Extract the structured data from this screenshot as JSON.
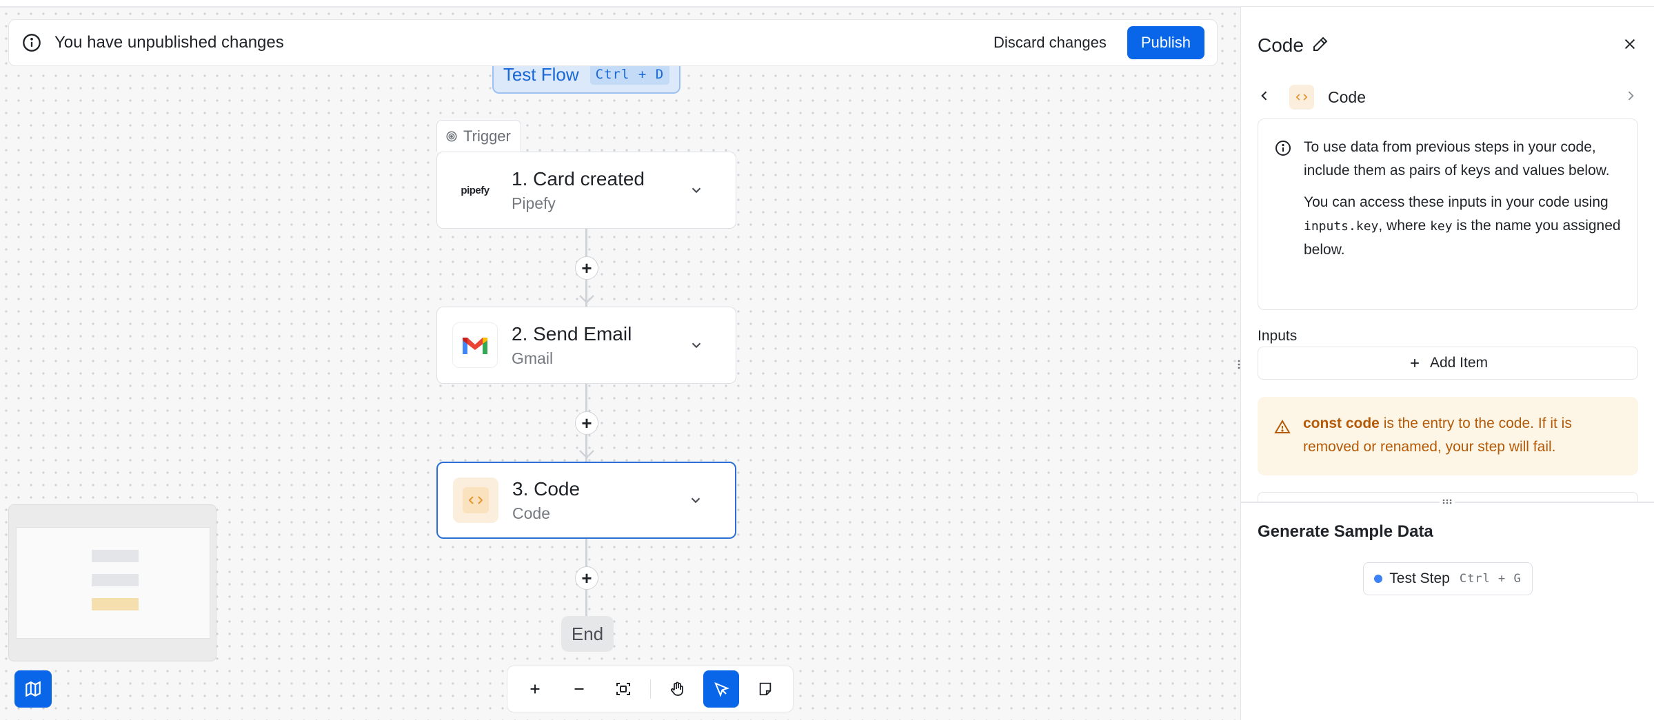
{
  "banner": {
    "message": "You have unpublished changes",
    "discard_label": "Discard changes",
    "publish_label": "Publish"
  },
  "test_flow": {
    "label": "Test Flow",
    "shortcut": "Ctrl + D"
  },
  "trigger_tag": "Trigger",
  "steps": [
    {
      "title": "1. Card created",
      "subtitle": "Pipefy",
      "logo_text": "pipefy",
      "icon": "pipefy-logo"
    },
    {
      "title": "2. Send Email",
      "subtitle": "Gmail",
      "icon": "gmail-icon"
    },
    {
      "title": "3. Code",
      "subtitle": "Code",
      "icon": "code-icon"
    }
  ],
  "end_label": "End",
  "panel": {
    "title": "Code",
    "step_name": "Code",
    "info_paragraph_1": "To use data from previous steps in your code, include them as pairs of keys and values below.",
    "info_p2_a": "You can access these inputs in your code using ",
    "info_p2_code1": "inputs.key",
    "info_p2_b": ", where ",
    "info_p2_code2": "key",
    "info_p2_c": " is the name you assigned below.",
    "inputs_label": "Inputs",
    "add_item_label": "Add Item",
    "warning_bold": "const code",
    "warning_text": " is the entry to the code. If it is removed or renamed, your step will fail.",
    "generate_title": "Generate Sample Data",
    "test_step_label": "Test Step",
    "test_step_shortcut": "Ctrl + G"
  },
  "colors": {
    "accent": "#0a66e8",
    "warning_bg": "#fdf6e6",
    "warning_text": "#b45a09",
    "test_flow_bg": "#dbe9fb"
  }
}
